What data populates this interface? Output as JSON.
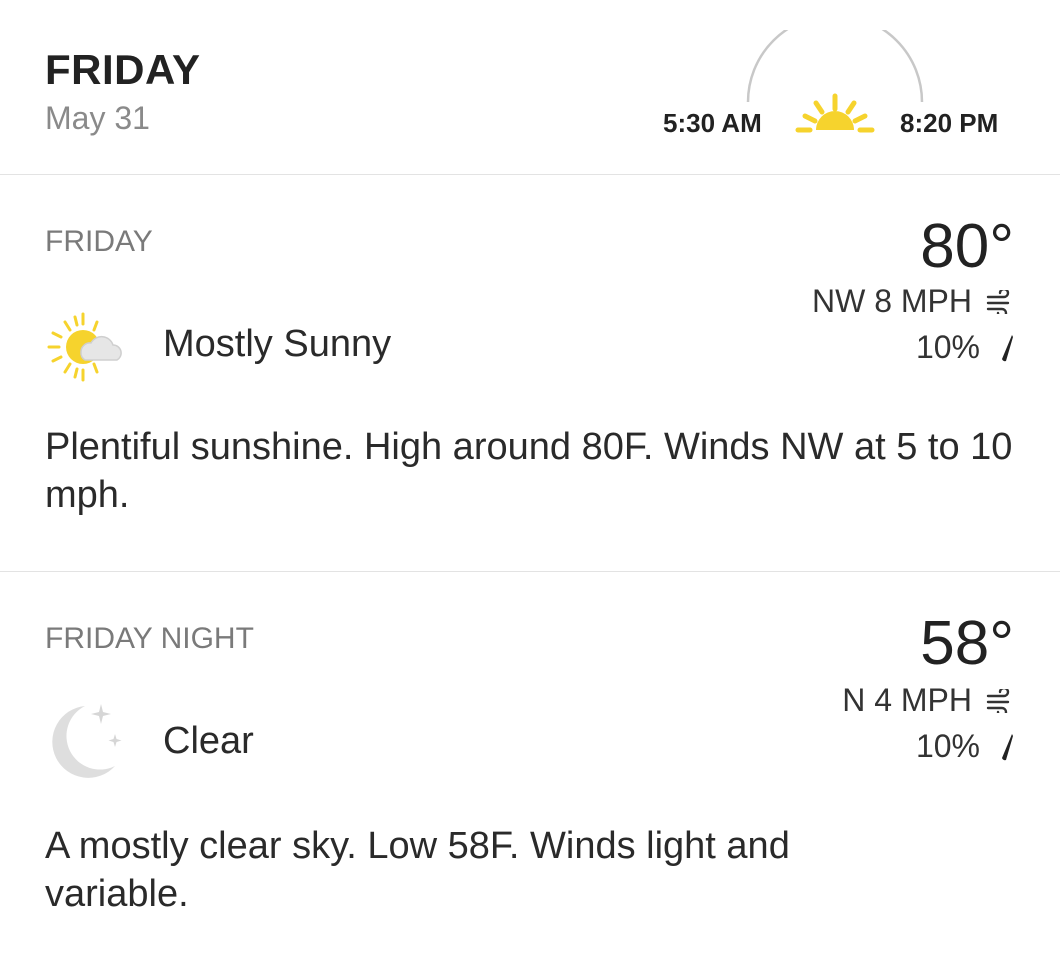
{
  "header": {
    "day": "FRIDAY",
    "date": "May 31",
    "sunrise": "5:30 AM",
    "sunset": "8:20 PM"
  },
  "periods": [
    {
      "label": "FRIDAY",
      "temperature": "80°",
      "condition": "Mostly Sunny",
      "condition_icon": "partly-sunny-icon",
      "wind": "NW 8 MPH",
      "precip": "10%",
      "description": "Plentiful sunshine. High around 80F. Winds NW at 5 to 10 mph."
    },
    {
      "label": "FRIDAY NIGHT",
      "temperature": "58°",
      "condition": "Clear",
      "condition_icon": "clear-night-moon-icon",
      "wind": "N 4 MPH",
      "precip": "10%",
      "description": "A mostly clear sky. Low 58F. Winds light and variable."
    }
  ],
  "colors": {
    "sun": "#f6d32d",
    "moon": "#d9d9d9",
    "muted_text": "#7a7a7a",
    "divider": "#e3e3e3"
  }
}
